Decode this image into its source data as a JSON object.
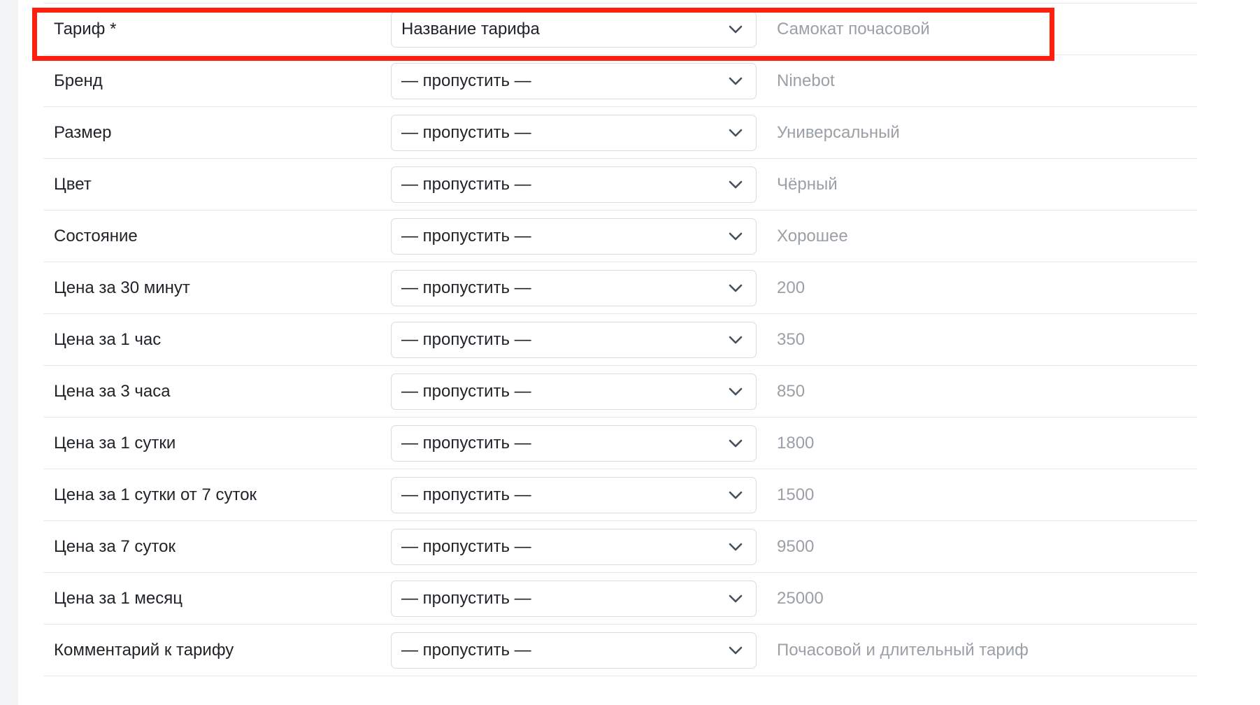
{
  "rows": [
    {
      "label": "Тариф *",
      "select": "Название тарифа",
      "sample": "Самокат почасовой"
    },
    {
      "label": "Бренд",
      "select": "— пропустить —",
      "sample": "Ninebot"
    },
    {
      "label": "Размер",
      "select": "— пропустить —",
      "sample": "Универсальный"
    },
    {
      "label": "Цвет",
      "select": "— пропустить —",
      "sample": "Чёрный"
    },
    {
      "label": "Состояние",
      "select": "— пропустить —",
      "sample": "Хорошее"
    },
    {
      "label": "Цена за 30 минут",
      "select": "— пропустить —",
      "sample": "200"
    },
    {
      "label": "Цена за 1 час",
      "select": "— пропустить —",
      "sample": "350"
    },
    {
      "label": "Цена за 3 часа",
      "select": "— пропустить —",
      "sample": "850"
    },
    {
      "label": "Цена за 1 сутки",
      "select": "— пропустить —",
      "sample": "1800"
    },
    {
      "label": "Цена за 1 сутки от 7 суток",
      "select": "— пропустить —",
      "sample": "1500"
    },
    {
      "label": "Цена за 7 суток",
      "select": "— пропустить —",
      "sample": "9500"
    },
    {
      "label": "Цена за 1 месяц",
      "select": "— пропустить —",
      "sample": "25000"
    },
    {
      "label": "Комментарий к тарифу",
      "select": "— пропустить —",
      "sample": "Почасовой и длительный тариф"
    }
  ],
  "icons": {
    "dropdown": "chevron-down-icon"
  },
  "colors": {
    "highlight": "#ff1f0f",
    "sample_text": "#9aa0a6",
    "chevron": "#44505c"
  }
}
